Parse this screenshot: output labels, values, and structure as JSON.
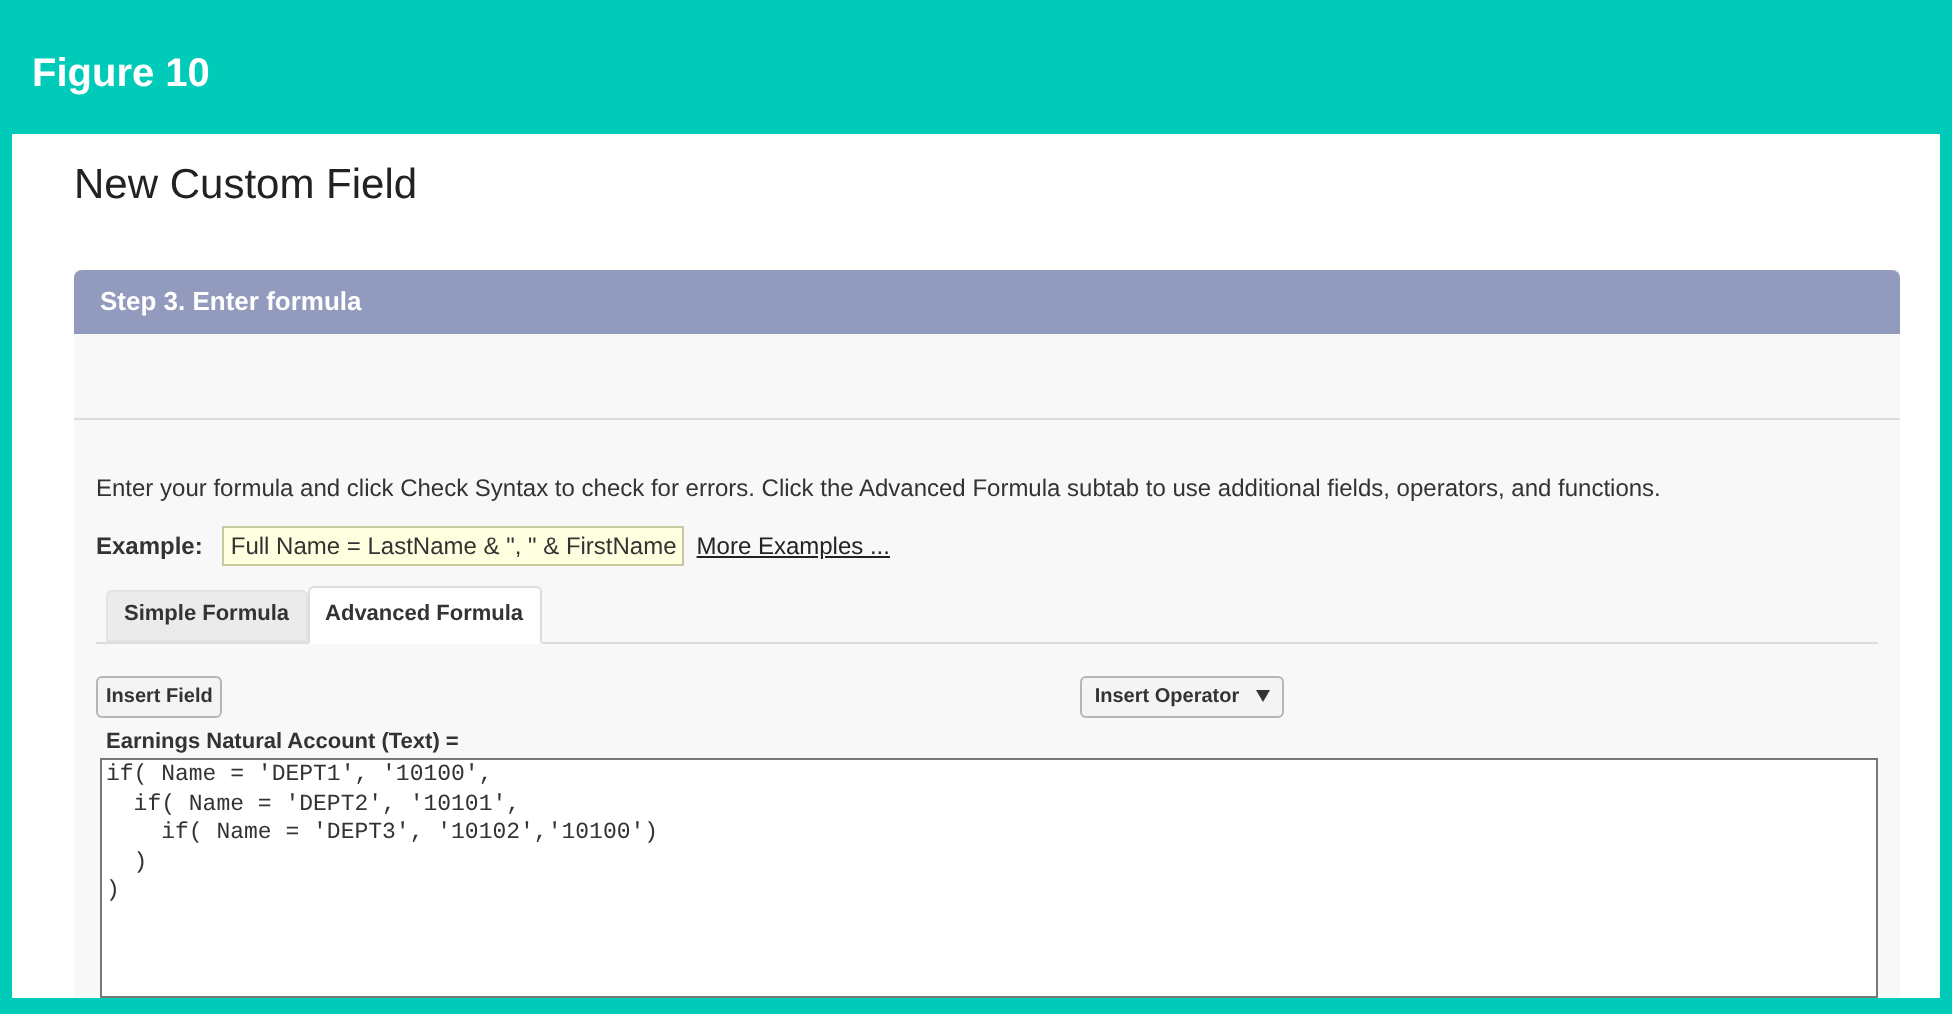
{
  "figure_title": "Figure 10",
  "page_title": "New Custom Field",
  "step": {
    "title": "Step 3. Enter formula"
  },
  "instructions": "Enter your formula and click Check Syntax to check for errors. Click the Advanced Formula subtab to use additional fields, operators, and functions.",
  "example": {
    "label": "Example:",
    "value": "Full Name = LastName & \", \" & FirstName",
    "link": "More Examples ..."
  },
  "tabs": [
    {
      "label": "Simple Formula",
      "selected": false
    },
    {
      "label": "Advanced Formula",
      "selected": true
    }
  ],
  "insert_field_button": "Insert Field",
  "insert_operator_button": "Insert Operator",
  "formula_label": "Earnings Natural Account (Text) =",
  "formula_lines": [
    "if( Name = 'DEPT1', '10100',",
    "  if( Name = 'DEPT2', '10101',",
    "    if( Name = 'DEPT3', '10102','10100')",
    "  )",
    ")"
  ]
}
